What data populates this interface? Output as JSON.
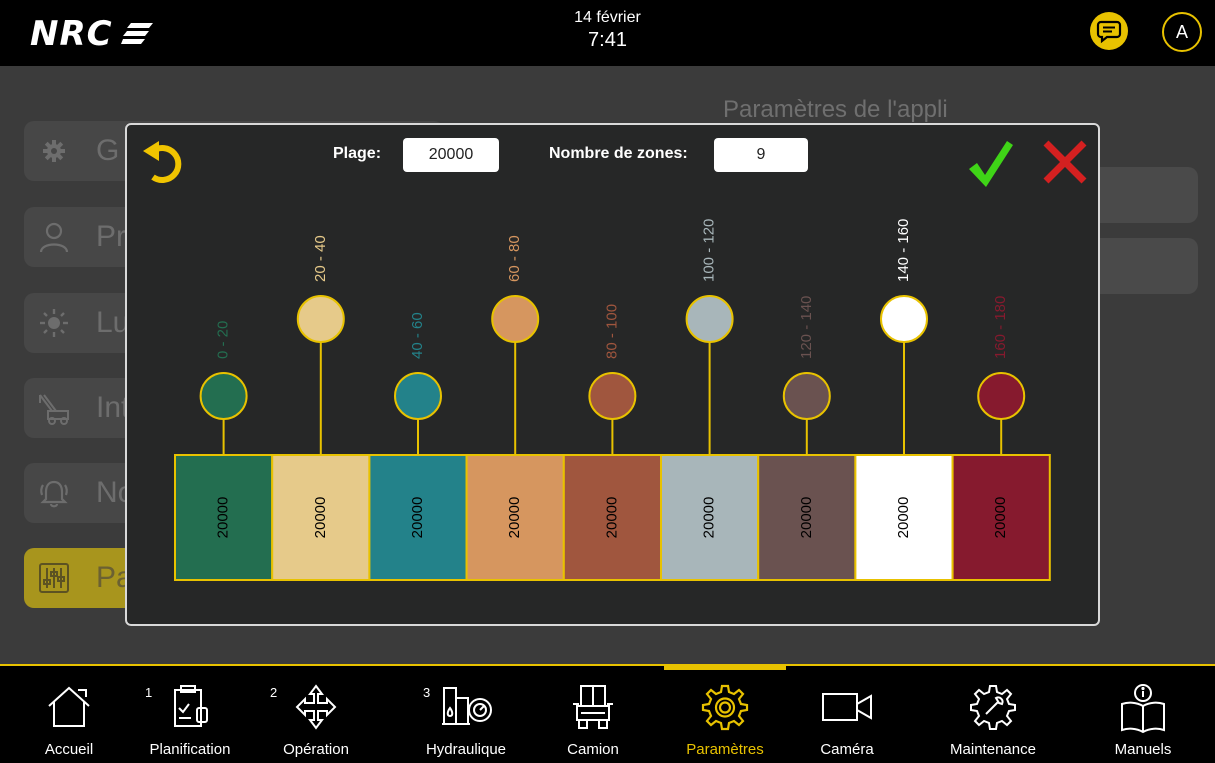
{
  "header": {
    "logo": "NRC",
    "date": "14 février",
    "time": "7:41",
    "avatar_initial": "A"
  },
  "background_page": {
    "title": "Paramètres de l'appli",
    "menu": [
      {
        "label": "G",
        "icon": "gear-icon"
      },
      {
        "label": "Pr",
        "icon": "user-icon"
      },
      {
        "label": "Lu",
        "icon": "brightness-icon"
      },
      {
        "label": "Int",
        "icon": "tow-truck-icon"
      },
      {
        "label": "No",
        "icon": "bell-icon"
      },
      {
        "label": "Pa",
        "icon": "sliders-icon",
        "active": true
      }
    ]
  },
  "dialog": {
    "plage_label": "Plage:",
    "plage_value": "20000",
    "zones_label": "Nombre de zones:",
    "zones_value": "9",
    "zones": [
      {
        "range": "0 - 20",
        "value": "20000",
        "color": "#236e50"
      },
      {
        "range": "20 - 40",
        "value": "20000",
        "color": "#e6ca8a"
      },
      {
        "range": "40 - 60",
        "value": "20000",
        "color": "#23828a"
      },
      {
        "range": "60 - 80",
        "value": "20000",
        "color": "#d6965f"
      },
      {
        "range": "80 - 100",
        "value": "20000",
        "color": "#a0563e"
      },
      {
        "range": "100 - 120",
        "value": "20000",
        "color": "#a8b6ba"
      },
      {
        "range": "120 - 140",
        "value": "20000",
        "color": "#6a5250"
      },
      {
        "range": "140 - 160",
        "value": "20000",
        "color": "#ffffff"
      },
      {
        "range": "160 - 180",
        "value": "20000",
        "color": "#861a2e"
      }
    ]
  },
  "colors": {
    "accent": "#e8c200",
    "confirm": "#3fd417",
    "cancel": "#d42020"
  },
  "nav": [
    {
      "label": "Accueil",
      "icon": "home-icon",
      "badge": ""
    },
    {
      "label": "Planification",
      "icon": "clipboard-icon",
      "badge": "1"
    },
    {
      "label": "Opération",
      "icon": "move-arrows-icon",
      "badge": "2"
    },
    {
      "label": "Hydraulique",
      "icon": "hydraulic-gauge-icon",
      "badge": "3"
    },
    {
      "label": "Camion",
      "icon": "truck-icon",
      "badge": ""
    },
    {
      "label": "Paramètres",
      "icon": "gear-icon",
      "badge": "",
      "active": true
    },
    {
      "label": "Caméra",
      "icon": "camera-icon",
      "badge": ""
    },
    {
      "label": "Maintenance",
      "icon": "wrench-gear-icon",
      "badge": ""
    },
    {
      "label": "Manuels",
      "icon": "manual-info-icon",
      "badge": ""
    }
  ]
}
